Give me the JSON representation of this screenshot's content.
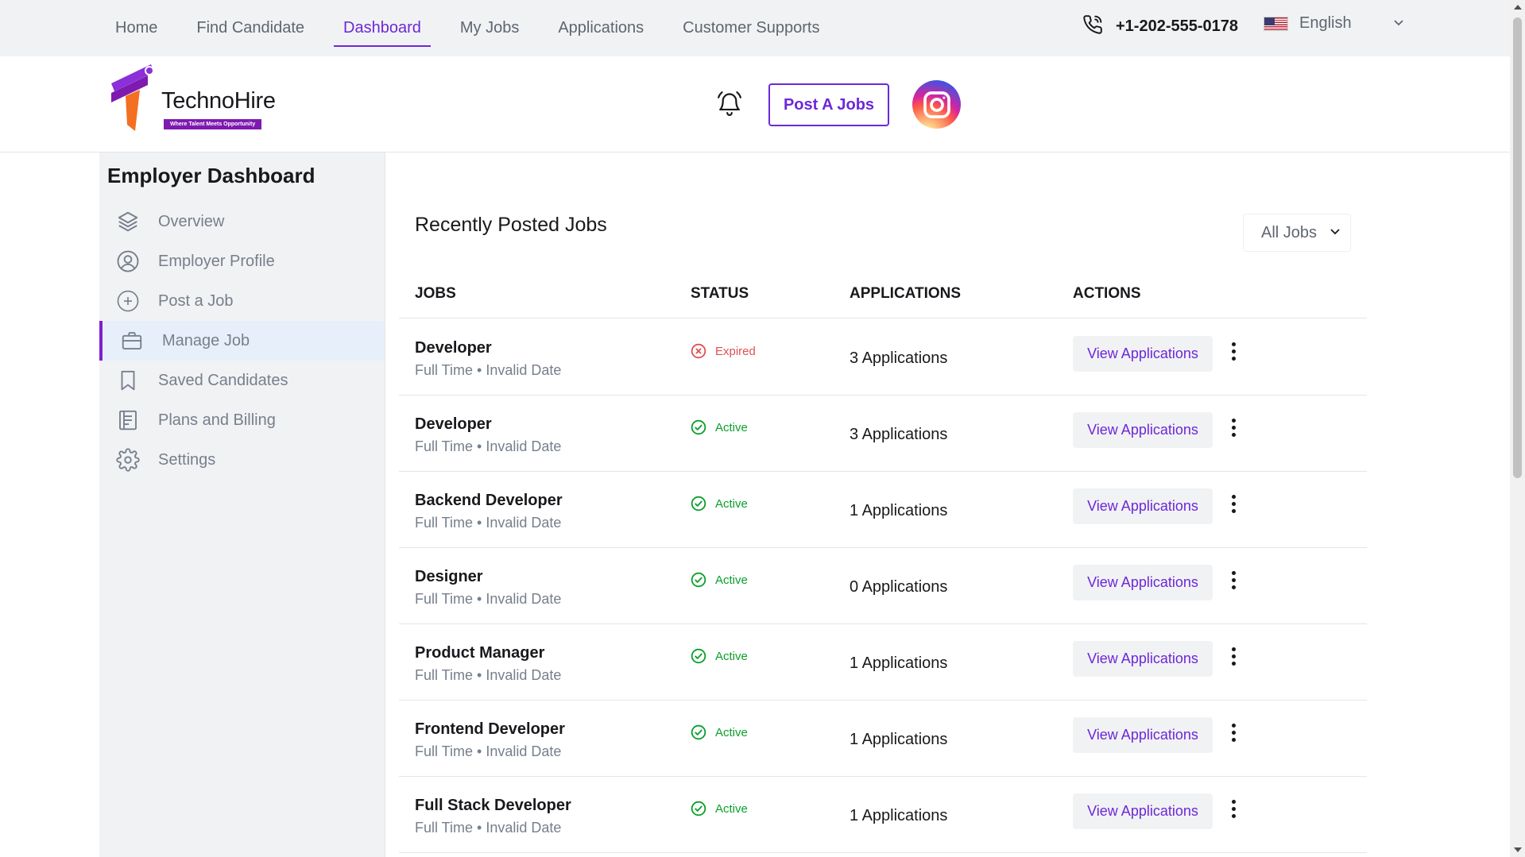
{
  "topnav": {
    "items": [
      "Home",
      "Find Candidate",
      "Dashboard",
      "My Jobs",
      "Applications",
      "Customer Supports"
    ],
    "active": "Dashboard",
    "phone": "+1-202-555-0178",
    "language": "English"
  },
  "header": {
    "brand": "TechnoHire",
    "tagline": "Where Talent Meets Opportunity",
    "post_button": "Post A Jobs",
    "icons": [
      "bell-icon",
      "instagram-icon"
    ]
  },
  "sidebar": {
    "title": "Employer Dashboard",
    "items": [
      {
        "label": "Overview",
        "icon": "layers-icon"
      },
      {
        "label": "Employer Profile",
        "icon": "user-circle-icon"
      },
      {
        "label": "Post a Job",
        "icon": "plus-circle-icon"
      },
      {
        "label": "Manage Job",
        "icon": "briefcase-icon"
      },
      {
        "label": "Saved Candidates",
        "icon": "bookmark-icon"
      },
      {
        "label": "Plans and Billing",
        "icon": "receipt-icon"
      },
      {
        "label": "Settings",
        "icon": "gear-icon"
      }
    ],
    "active_index": 3
  },
  "main": {
    "title": "Recently Posted Jobs",
    "filter": "All Jobs",
    "columns": [
      "JOBS",
      "STATUS",
      "APPLICATIONS",
      "ACTIONS"
    ],
    "action_label": "View Applications",
    "rows": [
      {
        "title": "Developer",
        "meta": "Full Time • Invalid Date",
        "status": "Expired",
        "applications": "3 Applications"
      },
      {
        "title": "Developer",
        "meta": "Full Time • Invalid Date",
        "status": "Active",
        "applications": "3 Applications"
      },
      {
        "title": "Backend Developer",
        "meta": "Full Time • Invalid Date",
        "status": "Active",
        "applications": "1 Applications"
      },
      {
        "title": "Designer",
        "meta": "Full Time • Invalid Date",
        "status": "Active",
        "applications": "0 Applications"
      },
      {
        "title": "Product Manager",
        "meta": "Full Time • Invalid Date",
        "status": "Active",
        "applications": "1 Applications"
      },
      {
        "title": "Frontend Developer",
        "meta": "Full Time • Invalid Date",
        "status": "Active",
        "applications": "1 Applications"
      },
      {
        "title": "Full Stack Developer",
        "meta": "Full Time • Invalid Date",
        "status": "Active",
        "applications": "1 Applications"
      }
    ]
  },
  "colors": {
    "accent": "#6d28d9",
    "active_status": "#0ba02c",
    "expired_status": "#e05151",
    "topbar_bg": "#f1f2f4",
    "sidebar_active_bg": "#e7f0fa"
  }
}
